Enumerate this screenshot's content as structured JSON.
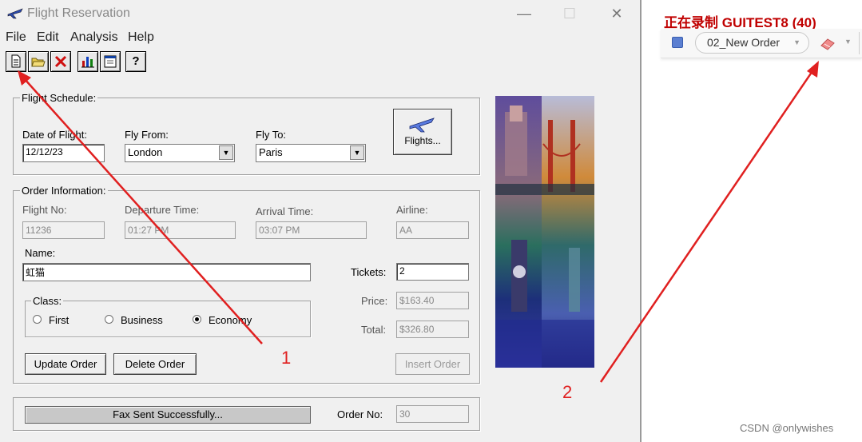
{
  "window": {
    "title": "Flight Reservation",
    "controls": {
      "minimize": "—",
      "maximize": "☐",
      "close": "✕"
    }
  },
  "menu": [
    "File",
    "Edit",
    "Analysis",
    "Help"
  ],
  "toolbar": {
    "buttons": [
      {
        "name": "new-order",
        "icon": "document-icon"
      },
      {
        "name": "open-order",
        "icon": "folder-open-icon"
      },
      {
        "name": "delete-order",
        "icon": "red-x-icon"
      },
      {
        "name": "graphs",
        "icon": "bar-chart-icon"
      },
      {
        "name": "fax-report",
        "icon": "report-icon"
      },
      {
        "name": "help",
        "icon": "question-icon",
        "label": "?"
      }
    ]
  },
  "flight_schedule": {
    "group_label": "Flight Schedule:",
    "date_label": "Date of Flight:",
    "date_value": "12/12/23",
    "from_label": "Fly From:",
    "from_value": "London",
    "to_label": "Fly To:",
    "to_value": "Paris",
    "flights_button": "Flights..."
  },
  "order_info": {
    "group_label": "Order Information:",
    "flight_no_label": "Flight No:",
    "flight_no_value": "11236",
    "departure_label": "Departure Time:",
    "departure_value": "01:27 PM",
    "arrival_label": "Arrival Time:",
    "arrival_value": "03:07 PM",
    "airline_label": "Airline:",
    "airline_value": "AA",
    "name_label": "Name:",
    "name_value": "虹猫",
    "tickets_label": "Tickets:",
    "tickets_value": "2",
    "price_label": "Price:",
    "price_value": "$163.40",
    "total_label": "Total:",
    "total_value": "$326.80",
    "class_label": "Class:",
    "class_options": [
      "First",
      "Business",
      "Economy"
    ],
    "class_selected": "Economy",
    "update_button": "Update Order",
    "delete_button": "Delete Order",
    "insert_button": "Insert Order"
  },
  "status": {
    "message": "Fax Sent Successfully...",
    "order_no_label": "Order No:",
    "order_no_value": "30"
  },
  "recorder": {
    "title": "正在录制 GUITEST8 (40)",
    "action_name": "02_New Order"
  },
  "annotations": {
    "arrow1_label": "1",
    "arrow2_label": "2"
  },
  "watermark": "CSDN @onlywishes",
  "colors": {
    "annotation": "#e02020",
    "recording_title": "#c00000",
    "window_bg": "#f0f0f0"
  }
}
